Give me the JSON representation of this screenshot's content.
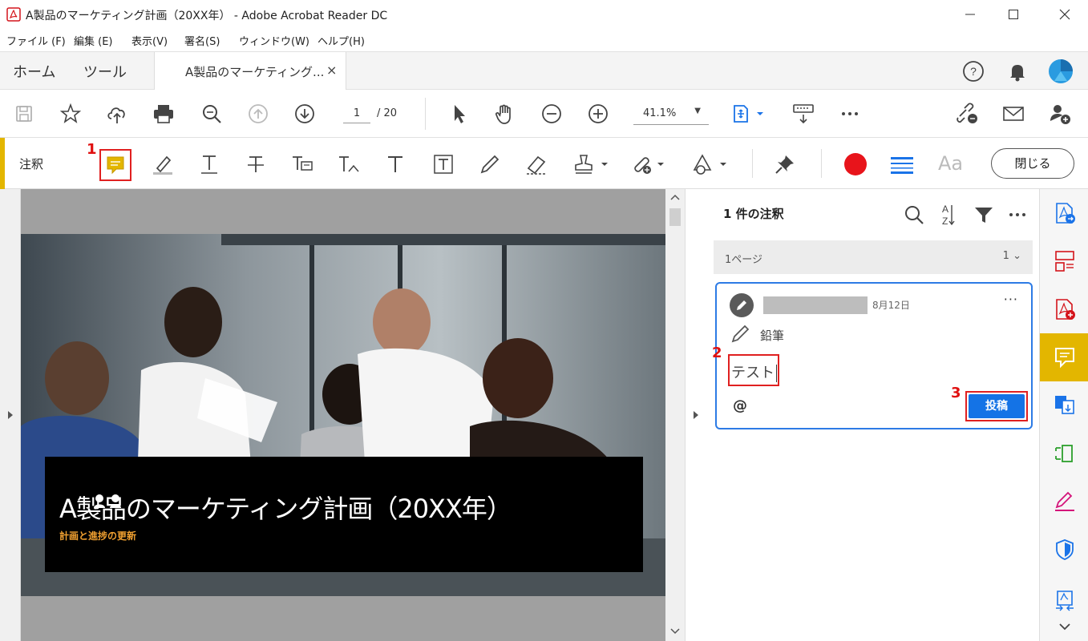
{
  "window": {
    "title": "A製品のマーケティング計画（20XX年） - Adobe Acrobat Reader DC"
  },
  "menu": [
    "ファイル (F)",
    "編集 (E)",
    "表示(V)",
    "署名(S)",
    "ウィンドウ(W)",
    "ヘルプ(H)"
  ],
  "tabs": {
    "home": "ホーム",
    "tools": "ツール",
    "document": "A製品のマーケティング...",
    "close": "×"
  },
  "toolbar": {
    "page_current": "1",
    "page_total": "/  20",
    "zoom": "41.1%"
  },
  "comment_toolbar": {
    "label": "注釈",
    "close_button": "閉じる",
    "text_style_label": "Aa",
    "record_color": "#e8141b",
    "accent_color": "#e3b600"
  },
  "document": {
    "title": "A製品のマーケティング計画（20XX年）",
    "subtitle": "計画と進捗の更新"
  },
  "comments_panel": {
    "header": "1 件の注釈",
    "page_group": "1ページ",
    "page_count": "1",
    "comment": {
      "date": "8月12日",
      "more": "···",
      "tool": "鉛筆",
      "reply_text": "テスト",
      "mention": "@",
      "post_button": "投稿"
    }
  },
  "annotations": {
    "step1": "1",
    "step2": "2",
    "step3": "3"
  }
}
